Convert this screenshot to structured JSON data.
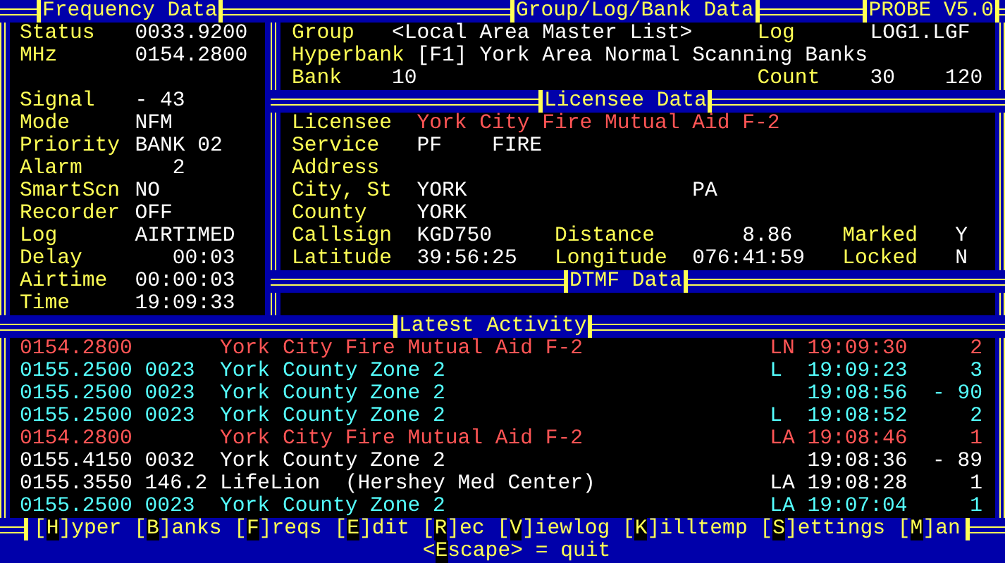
{
  "frequency_panel": {
    "title": "Frequency Data",
    "readout": [
      {
        "label": "Status",
        "value": "0033.9200"
      },
      {
        "label": "MHz",
        "value": "0154.2800"
      }
    ],
    "settings": [
      {
        "label": "Signal",
        "value": "- 43"
      },
      {
        "label": "Mode",
        "value": "NFM"
      },
      {
        "label": "Priority",
        "value": "BANK 02"
      },
      {
        "label": "Alarm",
        "value": "   2"
      },
      {
        "label": "SmartScn",
        "value": "NO"
      },
      {
        "label": "Recorder",
        "value": "OFF"
      },
      {
        "label": "Log",
        "value": "AIRTIMED"
      },
      {
        "label": "Delay",
        "value": "   00:03"
      },
      {
        "label": "Airtime",
        "value": "00:00:03"
      },
      {
        "label": "Time",
        "value": "19:09:33"
      }
    ]
  },
  "group_panel": {
    "title": "Group/Log/Bank Data",
    "app_title": "PROBE V5.0",
    "lines": [
      {
        "label": "Group",
        "value": "<Local Area Master List>",
        "right_label": "Log",
        "right_values": [
          "LOG1.LGF"
        ]
      },
      {
        "label": "Hyperbank",
        "value": "[F1] York Area Normal Scanning Banks"
      },
      {
        "label": "Bank",
        "value": "10",
        "right_label": "Count",
        "right_values": [
          "30",
          "120"
        ]
      }
    ]
  },
  "licensee_panel": {
    "title": "Licensee Data",
    "rows": [
      {
        "label": "Licensee",
        "value": "York City Fire Mutual Aid F-2",
        "alert": true
      },
      {
        "label": "Service",
        "value": "PF",
        "value_2": "FIRE",
        "alert": false
      },
      {
        "label": "Address"
      },
      {
        "label": "City, St",
        "value": "YORK",
        "state": "PA",
        "alert": false
      },
      {
        "label": "County",
        "value": "YORK",
        "alert": false
      },
      {
        "label": "Callsign",
        "value": "KGD750",
        "alert": false,
        "pairs": [
          {
            "label": "Distance",
            "value": "    8.86"
          },
          {
            "label": "Marked",
            "value": "Y"
          }
        ]
      },
      {
        "label": "Latitude",
        "value": "39:56:25",
        "alert": false,
        "pairs": [
          {
            "label": "Longitude",
            "value": "076:41:59"
          },
          {
            "label": "Locked",
            "value": "N"
          }
        ]
      }
    ]
  },
  "dtmf_panel": {
    "title": "DTMF Data"
  },
  "activity_panel": {
    "title": "Latest Activity",
    "rows": [
      {
        "frequency": "0154.2800",
        "name": "York City Fire Mutual Aid F-2",
        "flag": "LN",
        "time": "19:09:30",
        "value": "2",
        "color": "#ff5555"
      },
      {
        "frequency": "0155.2500",
        "code": "0023",
        "name": "York County Zone 2",
        "flag": "L",
        "time": "19:09:23",
        "value": "3",
        "color": "#55ffff"
      },
      {
        "frequency": "0155.2500",
        "code": "0023",
        "name": "York County Zone 2",
        "time": "19:08:56",
        "value": "- 90",
        "color": "#55ffff"
      },
      {
        "frequency": "0155.2500",
        "code": "0023",
        "name": "York County Zone 2",
        "flag": "L",
        "time": "19:08:52",
        "value": "2",
        "color": "#55ffff"
      },
      {
        "frequency": "0154.2800",
        "name": "York City Fire Mutual Aid F-2",
        "flag": "LA",
        "time": "19:08:46",
        "value": "1",
        "color": "#ff5555"
      },
      {
        "frequency": "0155.4150",
        "code": "0032",
        "name": "York County Zone 2",
        "time": "19:08:36",
        "value": "- 89",
        "color": "#ffffff"
      },
      {
        "frequency": "0155.3550",
        "code": "146.2",
        "name": "LifeLion  (Hershey Med Center)",
        "flag": "LA",
        "time": "19:08:28",
        "value": "1",
        "color": "#ffffff"
      },
      {
        "frequency": "0155.2500",
        "code": "0023",
        "name": "York County Zone 2",
        "flag": "LA",
        "time": "19:07:04",
        "value": "1",
        "color": "#55ffff"
      }
    ]
  },
  "menu": [
    {
      "open": "[",
      "hotkey": "H",
      "rest": "]yper"
    },
    {
      "open": "[",
      "hotkey": "B",
      "rest": "]anks"
    },
    {
      "open": "[",
      "hotkey": "F",
      "rest": "]reqs"
    },
    {
      "open": "[",
      "hotkey": "E",
      "rest": "]dit"
    },
    {
      "open": "[",
      "hotkey": "R",
      "rest": "]ec"
    },
    {
      "open": "[",
      "hotkey": "V",
      "rest": "]iewlog"
    },
    {
      "open": "[",
      "hotkey": "K",
      "rest": "]illtemp"
    },
    {
      "open": "[",
      "hotkey": "S",
      "rest": "]ettings"
    },
    {
      "open": "[",
      "hotkey": "M",
      "rest": "]an"
    }
  ],
  "quit": {
    "open": "<",
    "hotkey": "E",
    "rest": "scape> = quit"
  }
}
